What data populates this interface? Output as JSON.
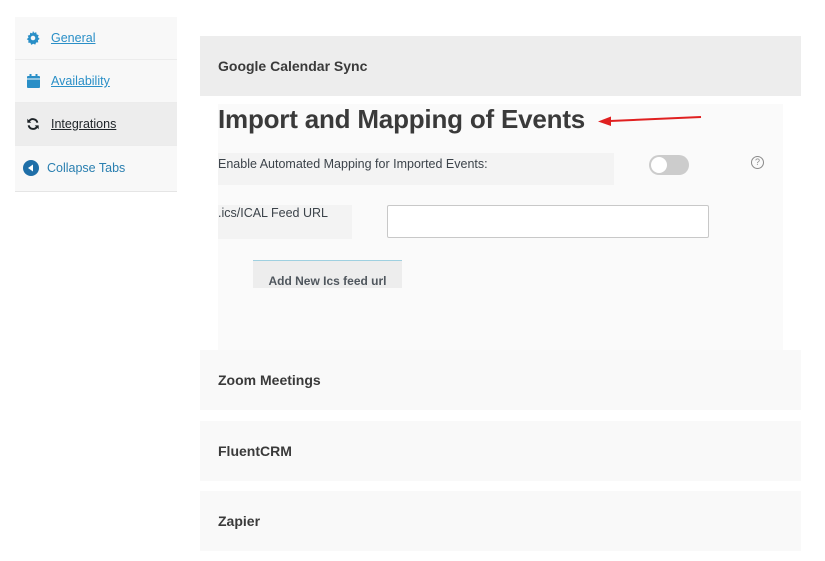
{
  "sidebar": {
    "items": [
      {
        "label": "General",
        "icon": "gear-icon",
        "active": false
      },
      {
        "label": "Availability",
        "icon": "calendar-icon",
        "active": false
      },
      {
        "label": "Integrations",
        "icon": "sync-icon",
        "active": true
      },
      {
        "label": "Collapse Tabs",
        "icon": "collapse-left-icon",
        "active": false
      }
    ]
  },
  "panels": {
    "google_calendar": {
      "title": "Google Calendar Sync",
      "section_title": "Import and Mapping of Events",
      "enable_mapping": {
        "label": "Enable Automated Mapping for Imported Events:",
        "enabled": false,
        "help_icon": "question-circle-icon",
        "help_glyph": "?"
      },
      "feed": {
        "label": ".ics/ICAL Feed URL",
        "value": "",
        "placeholder": ""
      },
      "add_button": "Add New Ics feed url"
    },
    "zoom": {
      "title": "Zoom Meetings"
    },
    "fluentcrm": {
      "title": "FluentCRM"
    },
    "zapier": {
      "title": "Zapier"
    }
  },
  "colors": {
    "link": "#2a8fc7",
    "annotation_arrow": "#e02020",
    "toggle_off": "#cccccc"
  }
}
